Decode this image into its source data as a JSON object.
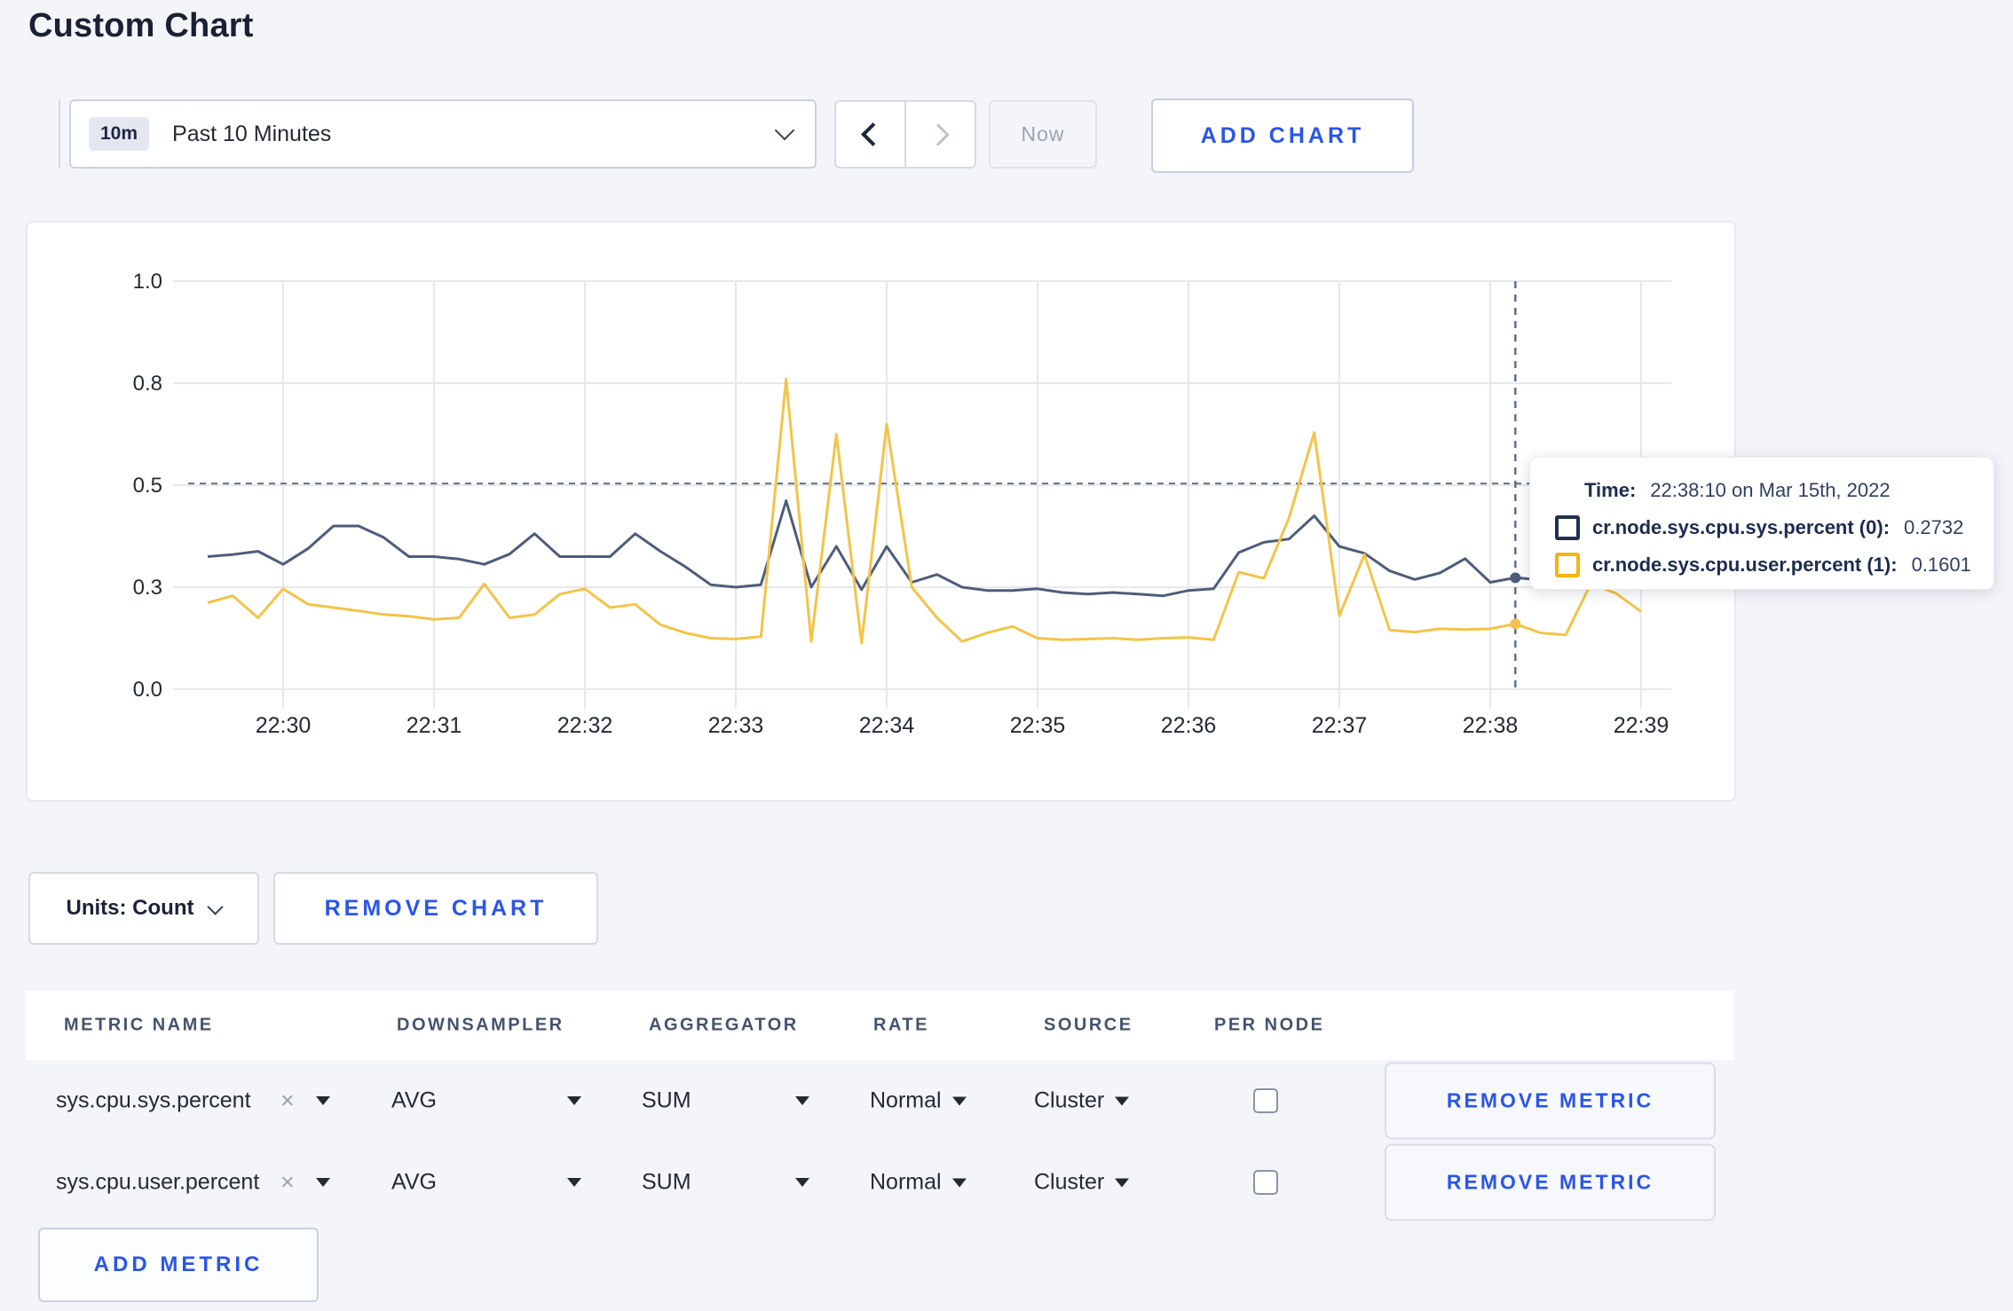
{
  "palette": {
    "accent_blue": "#2b55e8",
    "page_background": "#f4f5f9",
    "crosshair": "#5d7289",
    "gridline": "#e7e8ec"
  },
  "header": {
    "title": "Custom Chart"
  },
  "toolbar": {
    "time_range_badge": "10m",
    "time_range_label": "Past 10 Minutes",
    "now_label": "Now",
    "add_chart_label": "ADD CHART"
  },
  "chart_data": {
    "type": "line",
    "title": "",
    "xlabel": "",
    "ylabel": "",
    "x_start": "22:29:30",
    "x_step_seconds": 10,
    "x_ticks": [
      "22:30",
      "22:31",
      "22:32",
      "22:33",
      "22:34",
      "22:35",
      "22:36",
      "22:37",
      "22:38",
      "22:39"
    ],
    "y_ticks": [
      {
        "label": "0.0",
        "value": 0.0
      },
      {
        "label": "0.3",
        "value": 0.25
      },
      {
        "label": "0.5",
        "value": 0.5
      },
      {
        "label": "0.8",
        "value": 0.75
      },
      {
        "label": "1.0",
        "value": 1.0
      }
    ],
    "ylim": [
      0,
      1
    ],
    "grid": true,
    "hover_line_value": 0.504,
    "crosshair_index": 52,
    "crosshair_time": "22:38:10",
    "series": [
      {
        "name": "cr.node.sys.cpu.sys.percent (0)",
        "color": "#4e5d7a",
        "values": [
          0.325,
          0.33,
          0.338,
          0.306,
          0.345,
          0.4,
          0.4,
          0.372,
          0.325,
          0.325,
          0.319,
          0.306,
          0.331,
          0.381,
          0.325,
          0.325,
          0.325,
          0.381,
          0.338,
          0.3,
          0.256,
          0.25,
          0.256,
          0.462,
          0.25,
          0.35,
          0.244,
          0.35,
          0.262,
          0.281,
          0.25,
          0.242,
          0.242,
          0.246,
          0.237,
          0.233,
          0.237,
          0.233,
          0.229,
          0.242,
          0.246,
          0.335,
          0.36,
          0.368,
          0.425,
          0.35,
          0.333,
          0.29,
          0.269,
          0.285,
          0.32,
          0.262,
          0.2732,
          0.268,
          0.262,
          0.262,
          0.266,
          0.262
        ]
      },
      {
        "name": "cr.node.sys.cpu.user.percent (1)",
        "color": "#f3c449",
        "values": [
          0.212,
          0.229,
          0.175,
          0.246,
          0.208,
          0.2,
          0.192,
          0.183,
          0.179,
          0.171,
          0.175,
          0.258,
          0.175,
          0.183,
          0.233,
          0.246,
          0.2,
          0.208,
          0.158,
          0.138,
          0.125,
          0.123,
          0.129,
          0.76,
          0.117,
          0.625,
          0.113,
          0.65,
          0.25,
          0.175,
          0.117,
          0.138,
          0.154,
          0.125,
          0.121,
          0.123,
          0.125,
          0.121,
          0.125,
          0.127,
          0.121,
          0.287,
          0.272,
          0.42,
          0.629,
          0.18,
          0.33,
          0.145,
          0.14,
          0.148,
          0.146,
          0.148,
          0.1601,
          0.138,
          0.133,
          0.258,
          0.235,
          0.19
        ]
      }
    ]
  },
  "tooltip": {
    "time_label": "Time:",
    "time_value": "22:38:10 on Mar 15th, 2022",
    "series": [
      {
        "name": "cr.node.sys.cpu.sys.percent (0):",
        "value": "0.2732",
        "swatch_color": "#20314f"
      },
      {
        "name": "cr.node.sys.cpu.user.percent (1):",
        "value": "0.1601",
        "swatch_color": "#f3b50f"
      }
    ]
  },
  "chart_controls": {
    "units_label": "Units: Count",
    "remove_chart_label": "REMOVE CHART"
  },
  "metrics_table": {
    "headers": [
      "METRIC NAME",
      "DOWNSAMPLER",
      "AGGREGATOR",
      "RATE",
      "SOURCE",
      "PER NODE"
    ],
    "remove_metric_label": "REMOVE METRIC",
    "add_metric_label": "ADD METRIC",
    "clear_glyph": "×",
    "rows": [
      {
        "metric": "sys.cpu.sys.percent",
        "downsampler": "AVG",
        "aggregator": "SUM",
        "rate": "Normal",
        "source": "Cluster",
        "per_node_checked": false
      },
      {
        "metric": "sys.cpu.user.percent",
        "downsampler": "AVG",
        "aggregator": "SUM",
        "rate": "Normal",
        "source": "Cluster",
        "per_node_checked": false
      }
    ]
  }
}
